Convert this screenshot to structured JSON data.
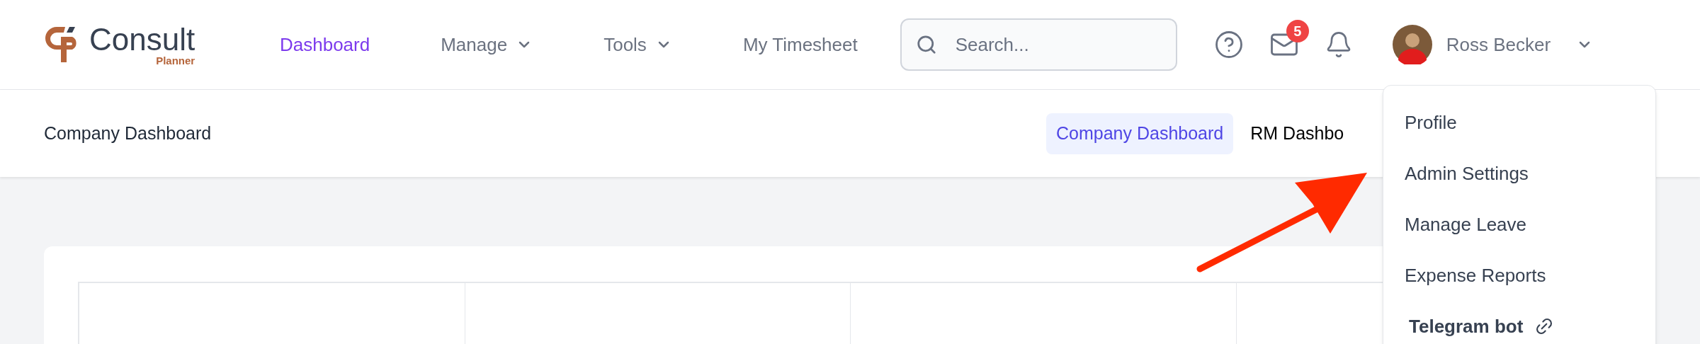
{
  "logo": {
    "word": "Consult",
    "subword": "Planner"
  },
  "nav": [
    {
      "label": "Dashboard",
      "selected": true,
      "has_menu": false
    },
    {
      "label": "Manage",
      "selected": false,
      "has_menu": true
    },
    {
      "label": "Tools",
      "selected": false,
      "has_menu": true
    },
    {
      "label": "My Timesheet",
      "selected": false,
      "has_menu": false
    }
  ],
  "search": {
    "placeholder": "Search..."
  },
  "messages_badge": "5",
  "user": {
    "name": "Ross Becker"
  },
  "page_title": "Company Dashboard",
  "dashboard_tabs": [
    {
      "label": "Company Dashboard",
      "selected": true
    },
    {
      "label": "RM Dashbo",
      "selected": false
    }
  ],
  "user_menu": {
    "items": [
      {
        "label": "Profile",
        "kind": "plain"
      },
      {
        "label": "Admin Settings",
        "kind": "plain"
      },
      {
        "label": "Manage Leave",
        "kind": "plain"
      },
      {
        "label": "Expense Reports",
        "kind": "plain"
      },
      {
        "label": "Telegram bot",
        "kind": "link"
      }
    ]
  }
}
